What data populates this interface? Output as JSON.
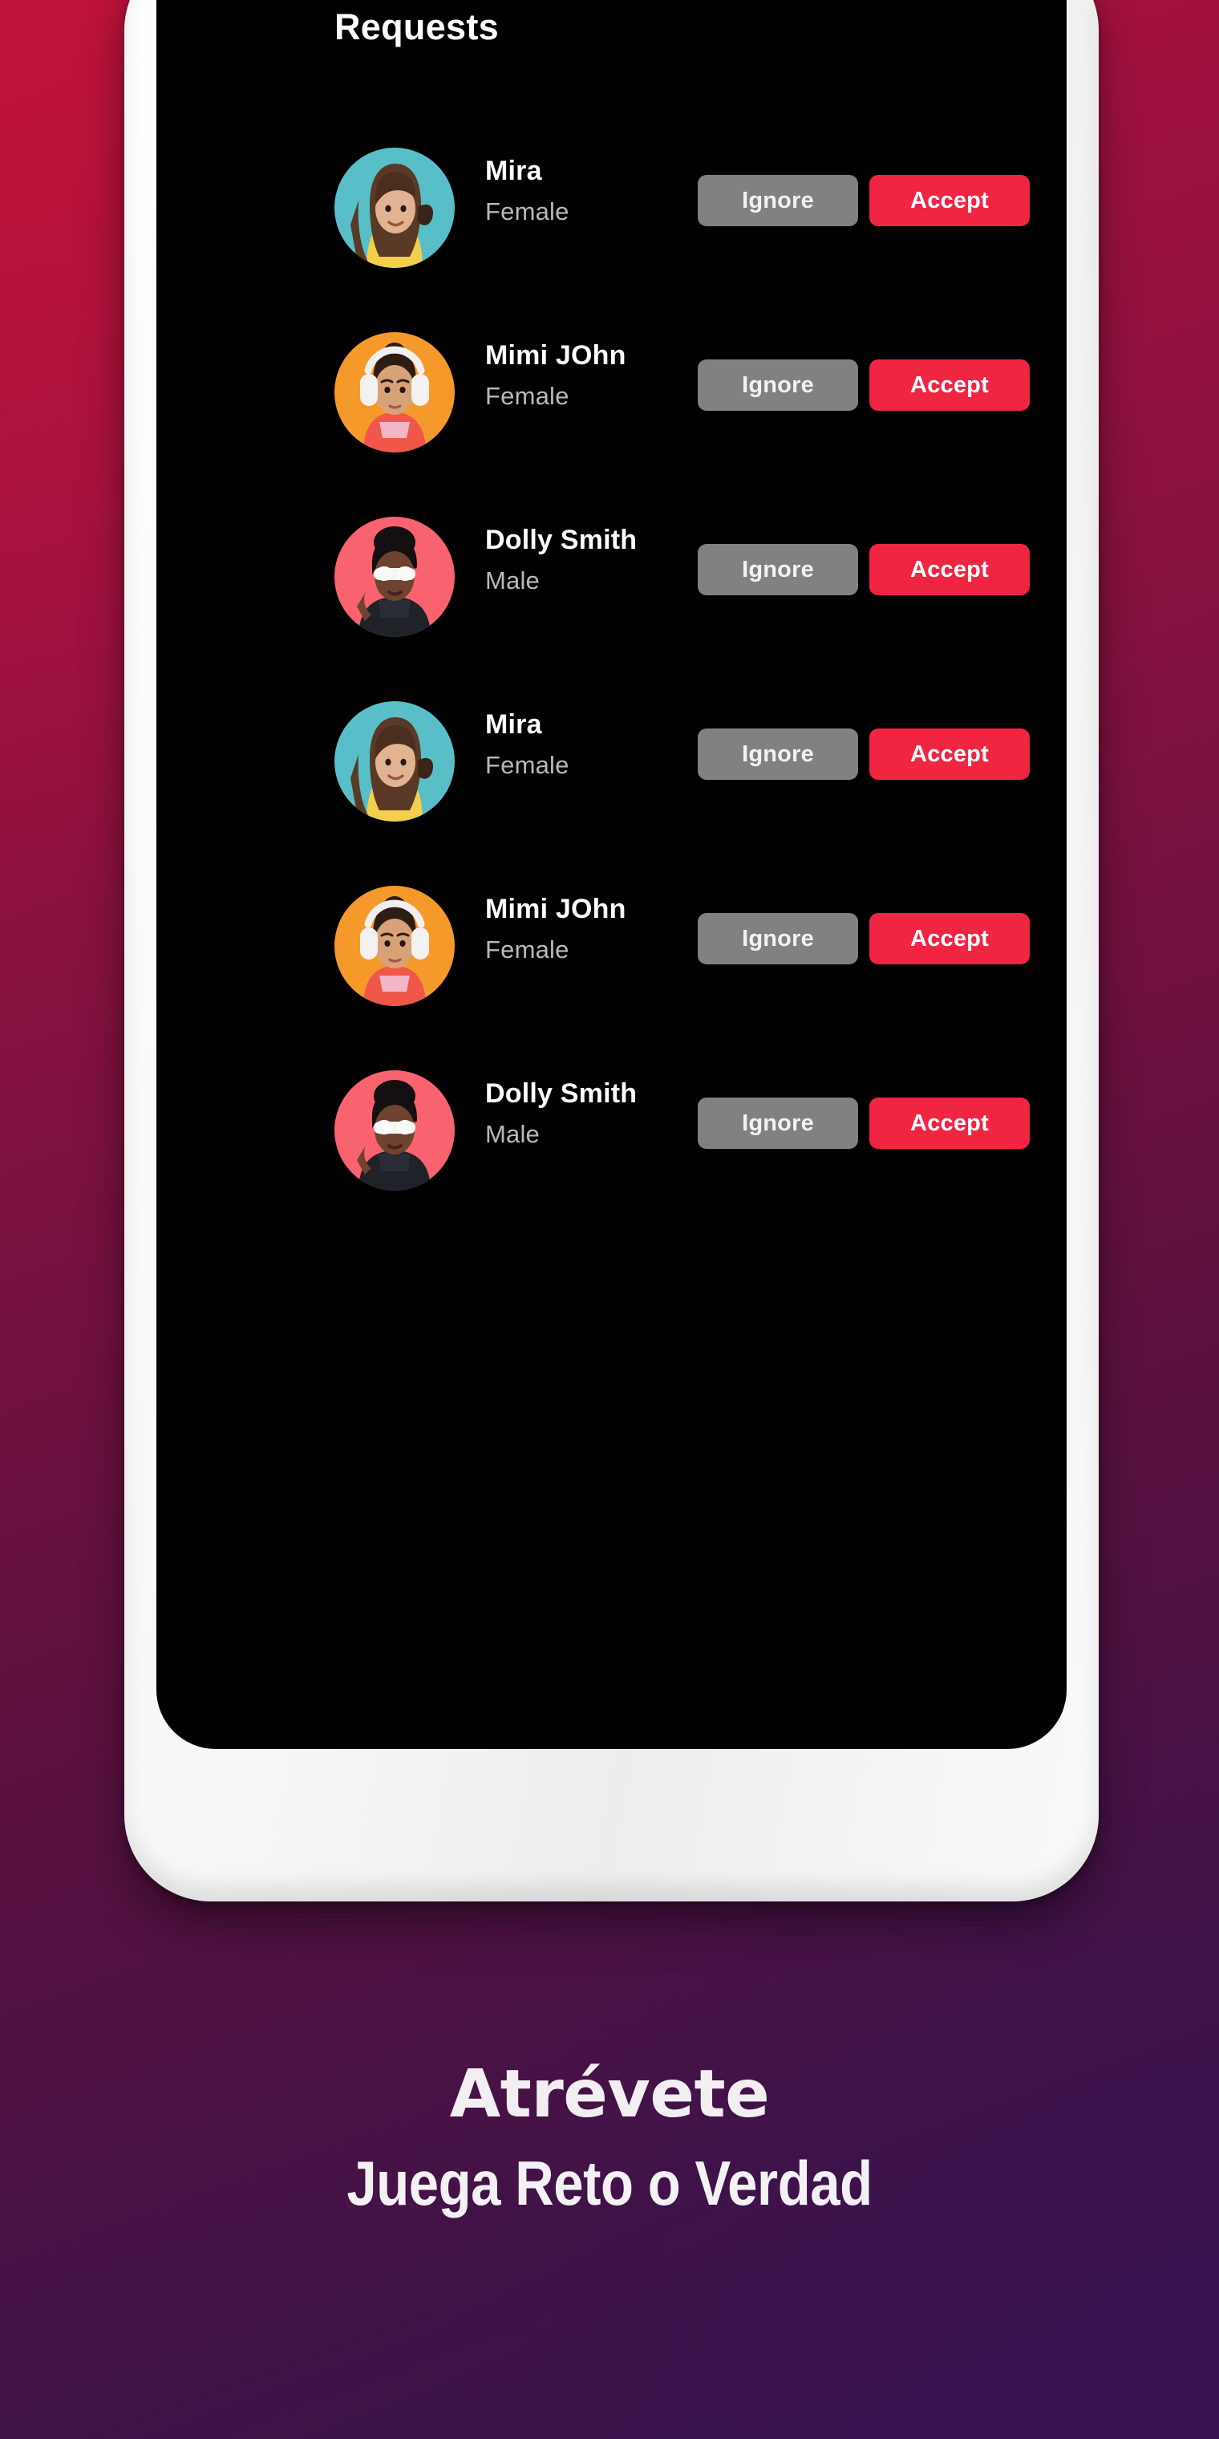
{
  "promo": {
    "headline": "Atrévete",
    "subhead": "Juega Reto o Verdad",
    "background_top_color": "#b5123a",
    "background_bottom_color": "#35134c"
  },
  "device": {
    "frame_color": "#ffffff",
    "screen_color": "#000000",
    "side_buttons": [
      "volume-button",
      "power-button"
    ]
  },
  "screen": {
    "title": "Requests",
    "accent_color": "#ef2542",
    "ignore_color": "#818181",
    "requests": [
      {
        "name": "Mira",
        "gender": "Female",
        "avatar_bg": "#58bfc8",
        "avatar_name": "avatar-mira",
        "ignore_label": "Ignore",
        "accept_label": "Accept"
      },
      {
        "name": "Mimi JOhn",
        "gender": "Female",
        "avatar_bg": "#f59a2a",
        "avatar_name": "avatar-mimi-john",
        "ignore_label": "Ignore",
        "accept_label": "Accept"
      },
      {
        "name": "Dolly Smith",
        "gender": "Male",
        "avatar_bg": "#f9636f",
        "avatar_name": "avatar-dolly-smith",
        "ignore_label": "Ignore",
        "accept_label": "Accept"
      },
      {
        "name": "Mira",
        "gender": "Female",
        "avatar_bg": "#58bfc8",
        "avatar_name": "avatar-mira",
        "ignore_label": "Ignore",
        "accept_label": "Accept"
      },
      {
        "name": "Mimi JOhn",
        "gender": "Female",
        "avatar_bg": "#f59a2a",
        "avatar_name": "avatar-mimi-john",
        "ignore_label": "Ignore",
        "accept_label": "Accept"
      },
      {
        "name": "Dolly Smith",
        "gender": "Male",
        "avatar_bg": "#f9636f",
        "avatar_name": "avatar-dolly-smith",
        "ignore_label": "Ignore",
        "accept_label": "Accept"
      }
    ]
  }
}
